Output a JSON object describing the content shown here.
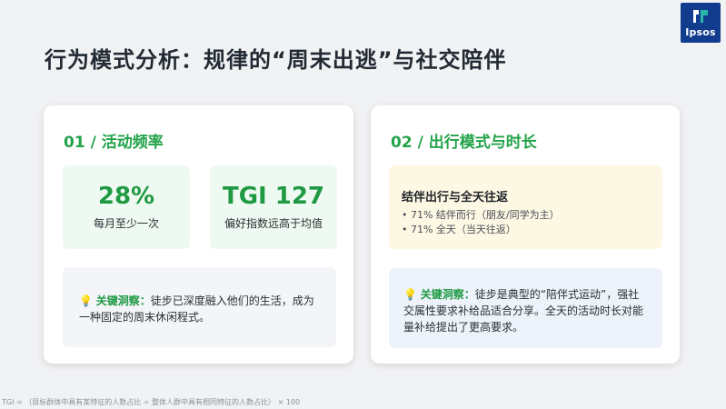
{
  "logo": {
    "text": "Ipsos"
  },
  "title": "行为模式分析：规律的“周末出逃”与社交陪伴",
  "left_card": {
    "title": "01 / 活动频率",
    "stats": [
      {
        "value": "28%",
        "label": "每月至少一次"
      },
      {
        "value": "TGI 127",
        "label": "偏好指数远高于均值"
      }
    ],
    "insight": {
      "icon": "lightbulb-icon",
      "label": "关键洞察：",
      "text": "徒步已深度融入他们的生活，成为一种固定的周末休闲程式。"
    }
  },
  "right_card": {
    "title": "02 / 出行模式与时长",
    "panel": {
      "title": "结伴出行与全天往返",
      "bullets": [
        "• 71% 结伴而行（朋友/同学为主）",
        "• 71% 全天（当天往返）"
      ]
    },
    "insight": {
      "icon": "lightbulb-icon",
      "label": "关键洞察：",
      "text": "徒步是典型的“陪伴式运动”，强社交属性要求补给品适合分享。全天的活动时长对能量补给提出了更高要求。"
    }
  },
  "footnote": "TGI = （目标群体中具有某特征的人数占比 ÷ 整体人群中具有相同特征的人数占比） × 100",
  "colors": {
    "accent_green": "#23a34a",
    "logo_blue": "#123d8f"
  }
}
